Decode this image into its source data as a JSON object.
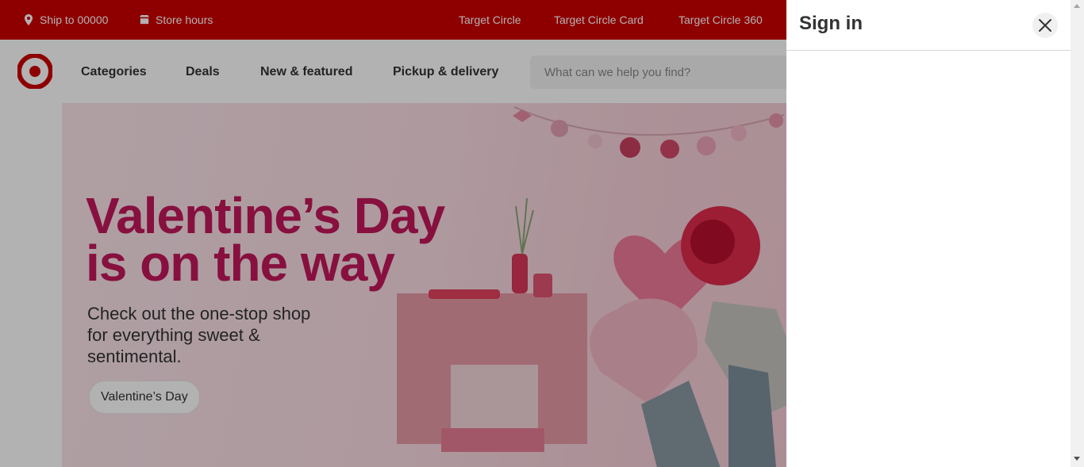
{
  "topbar": {
    "ship_to": "Ship to 00000",
    "store": "Store hours",
    "links": [
      "Target Circle",
      "Target Circle Card",
      "Target Circle 360"
    ]
  },
  "nav": {
    "links": [
      "Categories",
      "Deals",
      "New & featured",
      "Pickup & delivery"
    ],
    "search_placeholder": "What can we help you find?"
  },
  "hero": {
    "headline": "Valentine’s Day is on the way",
    "subtext": "Check out the one-stop shop for everything sweet & sentimental.",
    "button": "Valentine’s Day"
  },
  "signin": {
    "title": "Sign in",
    "close_icon": "close-icon"
  },
  "colors": {
    "brand": "#cc0000",
    "headline": "#c2185b",
    "overlay": "rgba(0,0,0,0.30)"
  }
}
